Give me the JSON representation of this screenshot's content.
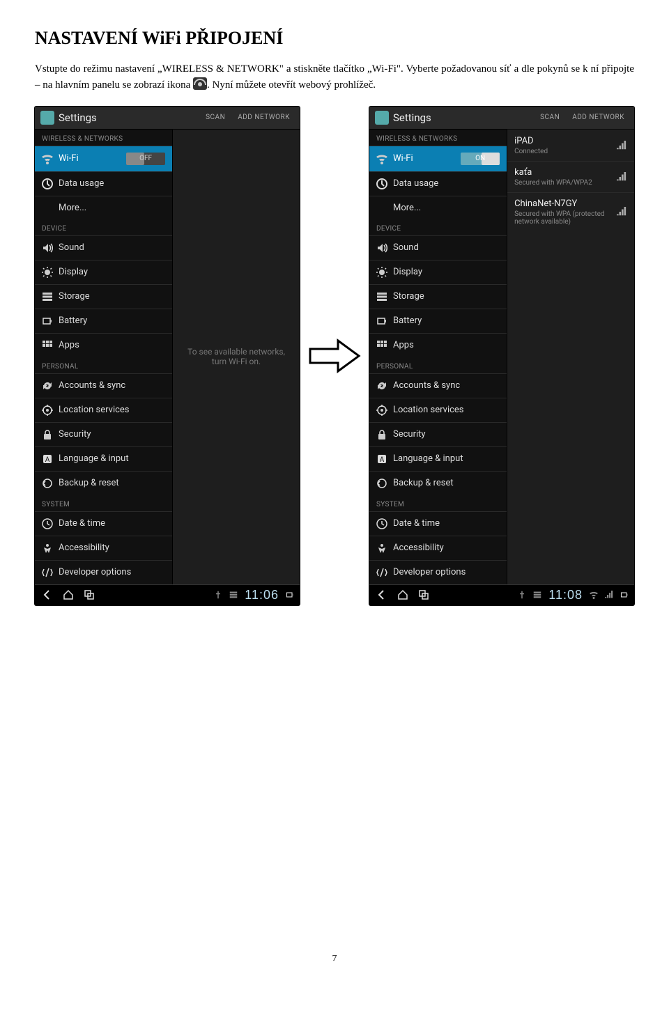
{
  "doc": {
    "heading": "NASTAVENÍ WiFi PŘIPOJENÍ",
    "para_part1": "Vstupte do režimu nastavení „WIRELESS & NETWORK\" a stiskněte tlačítko „Wi-Fi\". Vyberte požadovanou síť a dle pokynů se k ní připojte – na hlavním panelu se zobrazí ikona ",
    "para_part2": ". Nyní můžete otevřít webový prohlížeč.",
    "page_number": "7"
  },
  "shared": {
    "title": "Settings",
    "action_scan": "SCAN",
    "action_add": "ADD NETWORK",
    "sections": {
      "wireless": "WIRELESS & NETWORKS",
      "device": "DEVICE",
      "personal": "PERSONAL",
      "system": "SYSTEM"
    },
    "items": {
      "wifi": "Wi-Fi",
      "data_usage": "Data usage",
      "more": "More...",
      "sound": "Sound",
      "display": "Display",
      "storage": "Storage",
      "battery": "Battery",
      "apps": "Apps",
      "accounts": "Accounts & sync",
      "location": "Location services",
      "security": "Security",
      "language": "Language & input",
      "backup": "Backup & reset",
      "date": "Date & time",
      "accessibility": "Accessibility",
      "developer": "Developer options"
    },
    "toggle_off": "OFF",
    "toggle_on": "ON"
  },
  "left": {
    "right_pane_msg": "To see available networks, turn Wi-Fi on.",
    "clock": "11:06"
  },
  "right": {
    "networks": [
      {
        "name": "iPAD",
        "sub": "Connected"
      },
      {
        "name": "kaťa",
        "sub": "Secured with WPA/WPA2"
      },
      {
        "name": "ChinaNet-N7GY",
        "sub": "Secured with WPA (protected network available)"
      }
    ],
    "clock": "11:08"
  }
}
